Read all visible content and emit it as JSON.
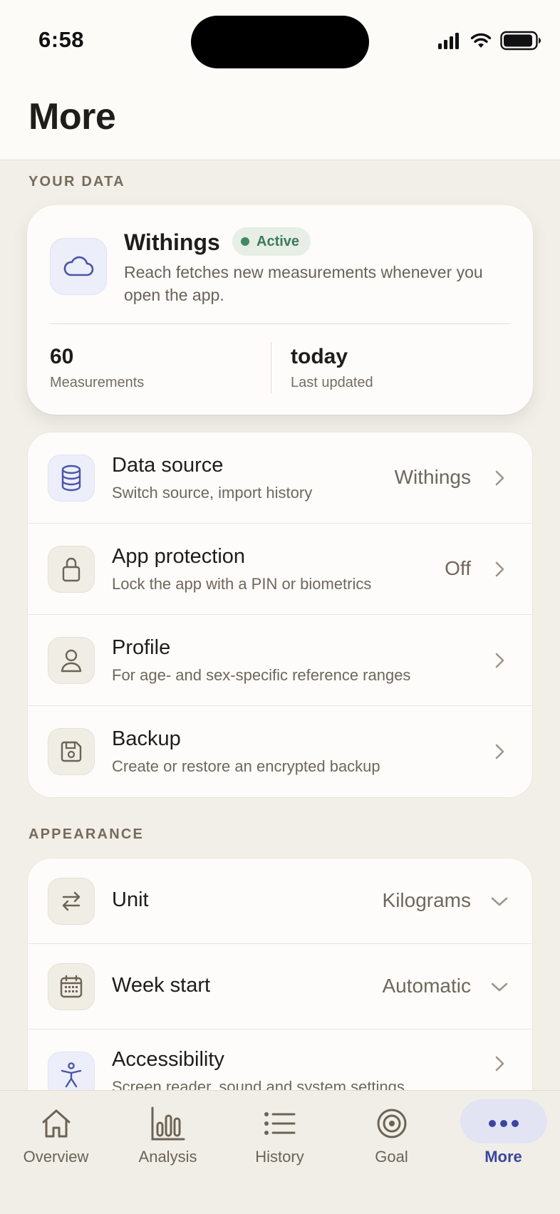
{
  "status_bar": {
    "time": "6:58"
  },
  "header": {
    "title": "More"
  },
  "sections": {
    "your_data": "YOUR DATA",
    "appearance": "APPEARANCE"
  },
  "withings_card": {
    "icon": "cloud-icon",
    "title": "Withings",
    "badge": "Active",
    "badge_color": "#3f8a63",
    "description": "Reach fetches new measurements whenever you open the app.",
    "stats": [
      {
        "value": "60",
        "label": "Measurements"
      },
      {
        "value": "today",
        "label": "Last updated"
      }
    ]
  },
  "data_rows": [
    {
      "icon": "database-icon",
      "title": "Data source",
      "subtitle": "Switch source, import history",
      "value": "Withings"
    },
    {
      "icon": "lock-icon",
      "title": "App protection",
      "subtitle": "Lock the app with a PIN or biometrics",
      "value": "Off"
    },
    {
      "icon": "person-icon",
      "title": "Profile",
      "subtitle": "For age- and sex-specific reference ranges",
      "value": ""
    },
    {
      "icon": "save-icon",
      "title": "Backup",
      "subtitle": "Create or restore an encrypted backup",
      "value": ""
    }
  ],
  "appearance_rows": [
    {
      "icon": "swap-icon",
      "title": "Unit",
      "value": "Kilograms"
    },
    {
      "icon": "calendar-icon",
      "title": "Week start",
      "value": "Automatic"
    },
    {
      "icon": "accessibility-icon",
      "title": "Accessibility",
      "subtitle": "Screen reader, sound and system settings"
    }
  ],
  "tabs": [
    {
      "icon": "home-icon",
      "label": "Overview"
    },
    {
      "icon": "bar-chart-icon",
      "label": "Analysis"
    },
    {
      "icon": "list-icon",
      "label": "History"
    },
    {
      "icon": "target-icon",
      "label": "Goal"
    },
    {
      "icon": "ellipsis-icon",
      "label": "More",
      "active": true
    }
  ],
  "colors": {
    "accent": "#3a46a0",
    "background": "#f2efe9",
    "card": "#fdfcfa"
  }
}
